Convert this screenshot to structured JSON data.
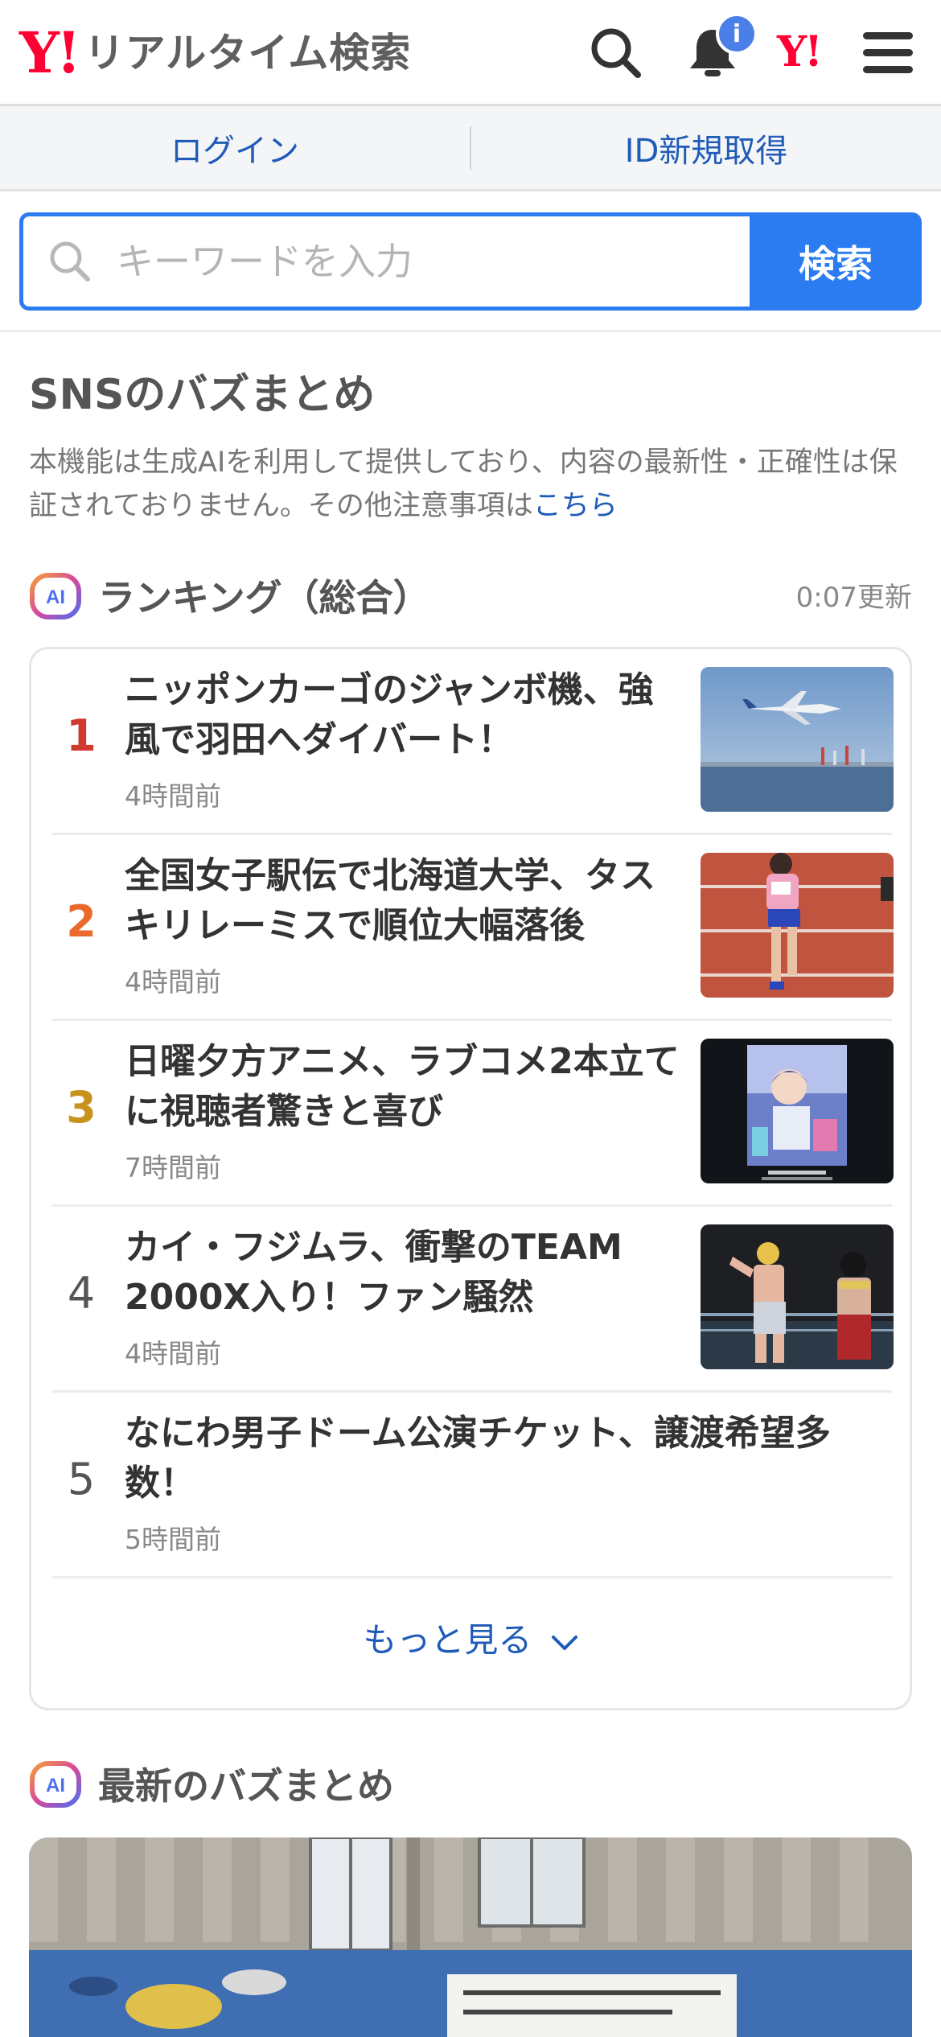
{
  "header": {
    "logo_mark": "Y!",
    "logo_text": "リアルタイム検索",
    "notification_badge": "i",
    "yahoo_mark": "Y!"
  },
  "auth": {
    "login": "ログイン",
    "signup": "ID新規取得"
  },
  "search": {
    "placeholder": "キーワードを入力",
    "button": "検索"
  },
  "section": {
    "title": "SNSのバズまとめ",
    "disclaimer": "本機能は生成AIを利用して提供しており、内容の最新性・正確性は保証されておりません。その他注意事項は",
    "disclaimer_link": "こちら"
  },
  "ranking": {
    "title": "ランキング（総合）",
    "updated": "0:07更新",
    "items": [
      {
        "rank": "1",
        "title": "ニッポンカーゴのジャンボ機、強風で羽田へダイバート！",
        "time": "4時間前",
        "rank_color": "#d03a2f",
        "thumb": "airplane-photo"
      },
      {
        "rank": "2",
        "title": "全国女子駅伝で北海道大学、タスキリレーミスで順位大幅落後",
        "time": "4時間前",
        "rank_color": "#ea6a2d",
        "thumb": "runner-photo"
      },
      {
        "rank": "3",
        "title": "日曜夕方アニメ、ラブコメ2本立てに視聴者驚きと喜び",
        "time": "7時間前",
        "rank_color": "#c8921f",
        "thumb": "anime-poster-photo"
      },
      {
        "rank": "4",
        "title": "カイ・フジムラ、衝撃のTEAM 2000X入り！ファン騒然",
        "time": "4時間前",
        "rank_color": "#555555",
        "thumb": "wrestling-photo"
      },
      {
        "rank": "5",
        "title": "なにわ男子ドーム公演チケット、譲渡希望多数！",
        "time": "5時間前",
        "rank_color": "#555555",
        "thumb": ""
      }
    ],
    "more": "もっと見る"
  },
  "latest": {
    "title": "最新のバズまとめ",
    "ai_badge": "AI"
  },
  "ai_badge": "AI",
  "colors": {
    "accent": "#2b7cf0",
    "link": "#1f5bb7",
    "brand": "#ff0033"
  }
}
